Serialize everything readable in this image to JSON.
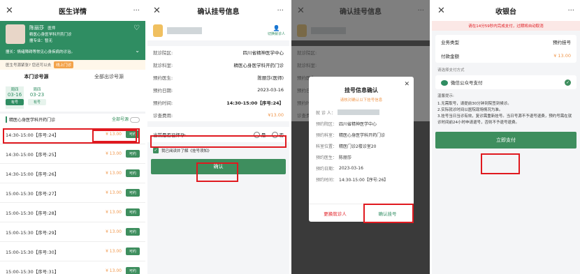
{
  "panel1": {
    "title": "医生详情",
    "doctor": {
      "name": "陈丽莎",
      "title": "医师",
      "dept": "精医心身医学科开药门诊",
      "spec_label": "擅专业：",
      "spec_value": "暂无",
      "good_at": "擅长：情绪障碍等常见心身疾病的诊治。"
    },
    "notice": {
      "text": "医生号源紧张? 您还可以去",
      "tag": "线上门诊"
    },
    "tabs": [
      "本门诊号源",
      "全部出诊号源"
    ],
    "dates": [
      {
        "week": "周四",
        "date": "03-16",
        "count": "有号"
      },
      {
        "week": "周四",
        "date": "03-23",
        "count": "有号"
      }
    ],
    "section": {
      "dept": "精医心身医学科开药门诊",
      "toggle_label": "全部号源"
    },
    "slots": [
      {
        "time": "14:30-15:00【序号:24】",
        "price": "¥ 13.00",
        "status": "可约"
      },
      {
        "time": "14:30-15:00【序号:25】",
        "price": "¥ 13.00",
        "status": "可约"
      },
      {
        "time": "14:30-15:00【序号:26】",
        "price": "¥ 13.00",
        "status": "可约"
      },
      {
        "time": "15:00-15:30【序号:27】",
        "price": "¥ 13.00",
        "status": "可约"
      },
      {
        "time": "15:00-15:30【序号:28】",
        "price": "¥ 13.00",
        "status": "可约"
      },
      {
        "time": "15:00-15:30【序号:29】",
        "price": "¥ 13.00",
        "status": "可约"
      },
      {
        "time": "15:00-15:30【序号:30】",
        "price": "¥ 13.00",
        "status": "可约"
      },
      {
        "time": "15:00-15:30【序号:31】",
        "price": "¥ 13.00",
        "status": "可约"
      }
    ]
  },
  "panel2": {
    "title": "确认挂号信息",
    "switch_patient": "切换就诊人",
    "rows": [
      {
        "k": "就诊院区:",
        "v": "四川省精神医学中心"
      },
      {
        "k": "就诊科室:",
        "v": "精医心身医学科开药门诊"
      },
      {
        "k": "预约医生:",
        "v": "陈丽莎(医师)"
      },
      {
        "k": "预约日期:",
        "v": "2023-03-16"
      },
      {
        "k": "预约时间:",
        "v": "14:30-15:00【序号:24】"
      },
      {
        "k": "诊查费用:",
        "v": "¥13.00"
      }
    ],
    "pregnant_q": "当前是否已怀孕:",
    "yes": "是",
    "no": "否",
    "agree_text": "我已阅读并了解《挂号须知》",
    "confirm": "确认"
  },
  "panel3": {
    "title": "确认挂号信息",
    "modal_title": "挂号信息确认",
    "modal_sub": "请核对确认以下挂号信息",
    "patient_label": "就 诊 人：",
    "rows": [
      {
        "k": "预约院区：",
        "v": "四川省精神医学中心"
      },
      {
        "k": "预约科室：",
        "v": "精医心身医学科开药门诊"
      },
      {
        "k": "科室位置：",
        "v": "精医门诊2楼诊室20"
      },
      {
        "k": "预约医生：",
        "v": "陈丽莎"
      },
      {
        "k": "预约日期：",
        "v": "2023-03-16"
      },
      {
        "k": "预约时间：",
        "v": "14:30-15:00【序号:26】"
      }
    ],
    "change": "更换就诊人",
    "confirm": "确认挂号",
    "bg_rows": [
      "就诊院区:",
      "就诊科室:",
      "预约医生:",
      "预约日期:",
      "预约时间:",
      "诊查费用:"
    ]
  },
  "panel4": {
    "title": "收银台",
    "warn": "请在14分59秒内完成支付，过期将自动取消",
    "biz_type_k": "业务类型",
    "biz_type_v": "预约挂号",
    "amount_k": "付款金额",
    "amount_v": "¥ 13.00",
    "pm_title": "请选择支付方式",
    "pm_label": "微信公众号支付",
    "tips_title": "温馨提示:",
    "tips": [
      "1.无需取号，请提前30分钟到院签到候诊。",
      "2.实际就诊时间以医院现场情况为准。",
      "3.挂号当日当诊有效，复诊需重新挂号。当日号源不予退号退费，预约号需在就诊时间前24小时申请退号，否则不予退号退费。"
    ],
    "pay": "立即支付"
  }
}
